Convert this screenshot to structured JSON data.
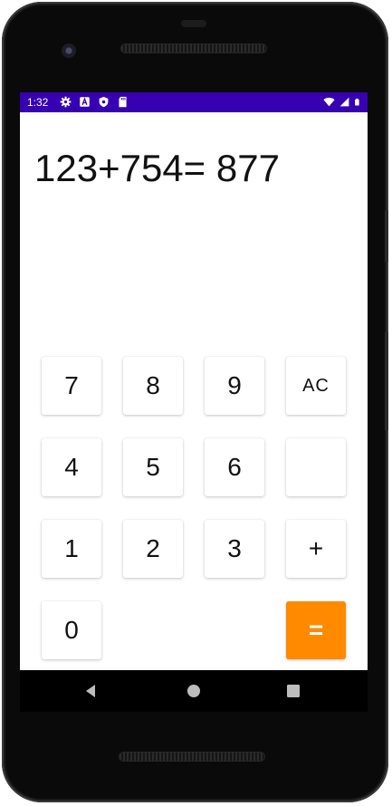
{
  "status_bar": {
    "time": "1:32",
    "icons_left": [
      "gear-icon",
      "a-badge-icon",
      "shield-icon",
      "sd-card-icon"
    ],
    "icons_right": [
      "wifi-icon",
      "signal-icon",
      "battery-icon"
    ],
    "background": "#3700b3"
  },
  "display": {
    "expression": "123+754= 877"
  },
  "keypad": {
    "key_7": "7",
    "key_8": "8",
    "key_9": "9",
    "key_ac": "AC",
    "key_4": "4",
    "key_5": "5",
    "key_6": "6",
    "key_blank": "",
    "key_1": "1",
    "key_2": "2",
    "key_3": "3",
    "key_plus": "+",
    "key_0": "0",
    "key_equals": "=",
    "equals_color": "#ff8a00"
  },
  "nav_bar": {
    "buttons": [
      "back-icon",
      "home-icon",
      "recents-icon"
    ]
  }
}
